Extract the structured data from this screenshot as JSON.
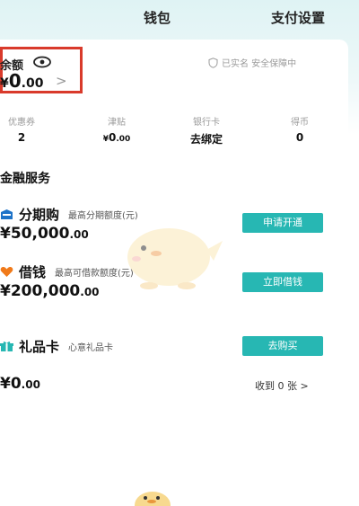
{
  "header": {
    "title": "钱包",
    "pay_settings": "支付设置"
  },
  "balance": {
    "label": "余额",
    "currency": "¥",
    "amount_int": "0",
    "amount_dec": ".00",
    "arrow": ">",
    "security_text": "已实名 安全保障中"
  },
  "stats": [
    {
      "label": "优惠券",
      "value": "2"
    },
    {
      "label": "津贴",
      "value_prefix": "¥",
      "value_int": "0",
      "value_dec": ".00"
    },
    {
      "label": "银行卡",
      "value": "去绑定"
    },
    {
      "label": "得币",
      "value": "0"
    }
  ],
  "finance": {
    "section_title": "金融服务",
    "installment": {
      "name": "分期购",
      "desc": "最高分期额度(元)",
      "amount_int": "¥50,000",
      "amount_dec": ".00",
      "button": "申请开通"
    },
    "loan": {
      "name": "借钱",
      "desc": "最高可借款额度(元)",
      "amount_int": "¥200,000",
      "amount_dec": ".00",
      "button": "立即借钱"
    },
    "gift_card": {
      "name": "礼品卡",
      "desc": "心意礼品卡",
      "amount_int": "¥0",
      "amount_dec": ".00",
      "button": "去购买",
      "received": "收到 0 张 >"
    }
  },
  "colors": {
    "accent": "#27b7b3",
    "highlight_border": "#d93a2b",
    "installment_icon": "#1e73c8",
    "loan_icon": "#f07a1a",
    "gift_icon": "#27b7b3"
  },
  "icons": [
    "eye-icon",
    "shield-icon",
    "card-icon",
    "heart-icon",
    "gift-icon",
    "mascot-icon"
  ]
}
